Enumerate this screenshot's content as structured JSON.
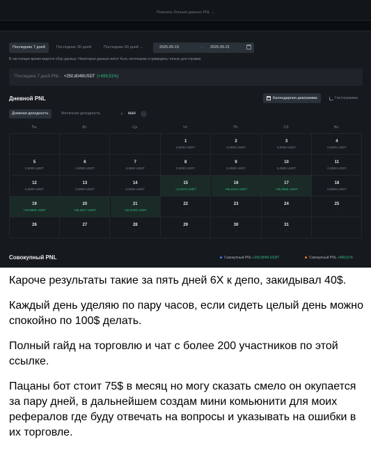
{
  "top": {
    "show_more": "Показать больше данных PNL"
  },
  "filters": {
    "periods": [
      "Последние 7 дней",
      "Последние 30 дней",
      "Последние 60 дней"
    ],
    "date_from": "2025-05-15",
    "date_separator": "→",
    "date_to": "2025-05-21",
    "notice": "В настоящее время ведется сбор данных. Некоторые данные могут быть неточными и приведены только для справки."
  },
  "summary": {
    "label": "Последние 7 дней PNL:",
    "value": "+250,8049USDT",
    "percent": "(+499,51%)"
  },
  "daily_pnl": {
    "title": "Дневной PNL",
    "calendar_button": "Календарная диаграмма",
    "histogram_button": "Гистограмма",
    "tabs": [
      "Дневная доходность",
      "Месячная доходность"
    ],
    "month": "мая",
    "month_prev": "‹",
    "weekdays": [
      "Пн",
      "Вт",
      "Ср",
      "Чт",
      "Пт",
      "Сб",
      "Вс"
    ],
    "cells": [
      {
        "day": "",
        "value": ""
      },
      {
        "day": "",
        "value": ""
      },
      {
        "day": "",
        "value": ""
      },
      {
        "day": "1",
        "value": "0,0000 USDT"
      },
      {
        "day": "2",
        "value": "0,0000 USDT"
      },
      {
        "day": "3",
        "value": "0,0000 USDT"
      },
      {
        "day": "4",
        "value": "0,0000 USDT"
      },
      {
        "day": "5",
        "value": "0,0000 USDT"
      },
      {
        "day": "6",
        "value": "0,0000 USDT"
      },
      {
        "day": "7",
        "value": "0,0000 USDT"
      },
      {
        "day": "8",
        "value": "0,0000 USDT"
      },
      {
        "day": "9",
        "value": "0,0000 USDT"
      },
      {
        "day": "10",
        "value": "0,0000 USDT"
      },
      {
        "day": "11",
        "value": "0,0000 USDT"
      },
      {
        "day": "12",
        "value": "0,0000 USDT"
      },
      {
        "day": "13",
        "value": "0,0000 USDT"
      },
      {
        "day": "14",
        "value": "0,0000 USDT"
      },
      {
        "day": "15",
        "value": "+2,0474 USDT"
      },
      {
        "day": "16",
        "value": "+96,2410 USDT"
      },
      {
        "day": "17",
        "value": "+35,0685 USDT"
      },
      {
        "day": "18",
        "value": "0,0000 USDT"
      },
      {
        "day": "19",
        "value": "+28,5908 USDT"
      },
      {
        "day": "20",
        "value": "+56,4817 USDT"
      },
      {
        "day": "21",
        "value": "+32,3755 USDT"
      },
      {
        "day": "22",
        "value": "--"
      },
      {
        "day": "23",
        "value": "--"
      },
      {
        "day": "24",
        "value": "--"
      },
      {
        "day": "25",
        "value": "--"
      },
      {
        "day": "26",
        "value": "--"
      },
      {
        "day": "27",
        "value": "--"
      },
      {
        "day": "28",
        "value": "--"
      },
      {
        "day": "29",
        "value": "--"
      },
      {
        "day": "30",
        "value": "--"
      },
      {
        "day": "31",
        "value": "--"
      },
      {
        "day": "",
        "value": ""
      }
    ]
  },
  "cumulative": {
    "title": "Совокупный PNL",
    "legend": [
      {
        "label": "Совокупный PNL",
        "value": "+250,8049 USDT",
        "color": "#3b82f6"
      },
      {
        "label": "Совокупный PNL",
        "value": "+499,51%",
        "color": "#f07b2d"
      }
    ]
  },
  "colors": {
    "positive": "#2ebd85",
    "panel": "#16191d"
  },
  "message": {
    "paragraphs": [
      "Кароче результаты такие за пять дней 6Х к депо, закидывал 40$.",
      "Каждый день уделяю по пару часов, если сидеть целый день можно спокойно по 100$ делать.",
      "Полный гайд на торговлю и чат с более 200 участников по этой ссылке.",
      "Пацаны бот стоит 75$ в месяц но могу сказать смело он окупается за пару дней, в дальнейшем создам мини комьюнити для моих рефералов где буду отвечать на вопросы и указывать на ошибки в их торговле."
    ]
  }
}
